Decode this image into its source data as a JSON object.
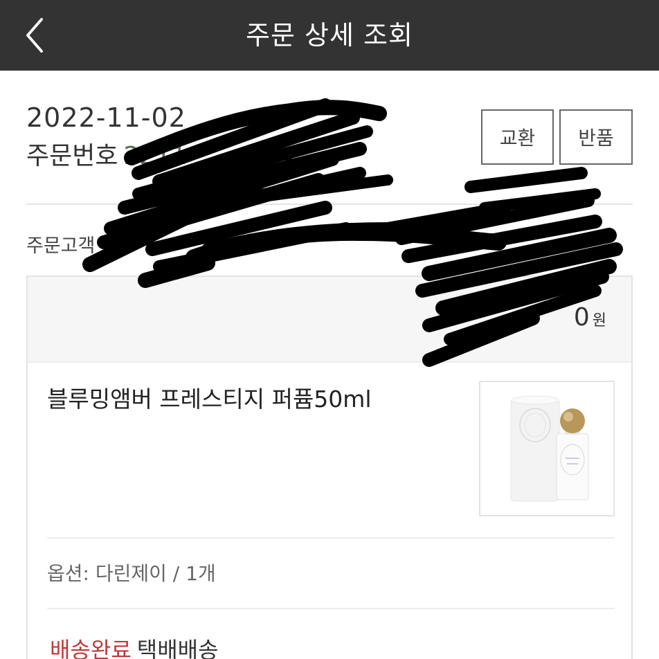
{
  "header": {
    "title": "주문 상세 조회"
  },
  "order": {
    "date": "2022-11-02",
    "number_label": "주문번호",
    "number_value": "2211",
    "exchange_label": "교환",
    "return_label": "반품",
    "customer_label": "주문고객 :"
  },
  "item": {
    "price_value": "0",
    "price_unit": "원",
    "product_name": "블루밍앰버 프레스티지 퍼퓸50ml",
    "option": "옵션: 다린제이 / 1개",
    "status": "배송완료",
    "delivery_method": "택배배송"
  },
  "colors": {
    "header_bg": "#333333",
    "status_red": "#c0393b",
    "order_number": "#5c6e5e"
  },
  "icons": {
    "back": "chevron-left-icon",
    "thumbnail": "perfume-bottle-image"
  }
}
